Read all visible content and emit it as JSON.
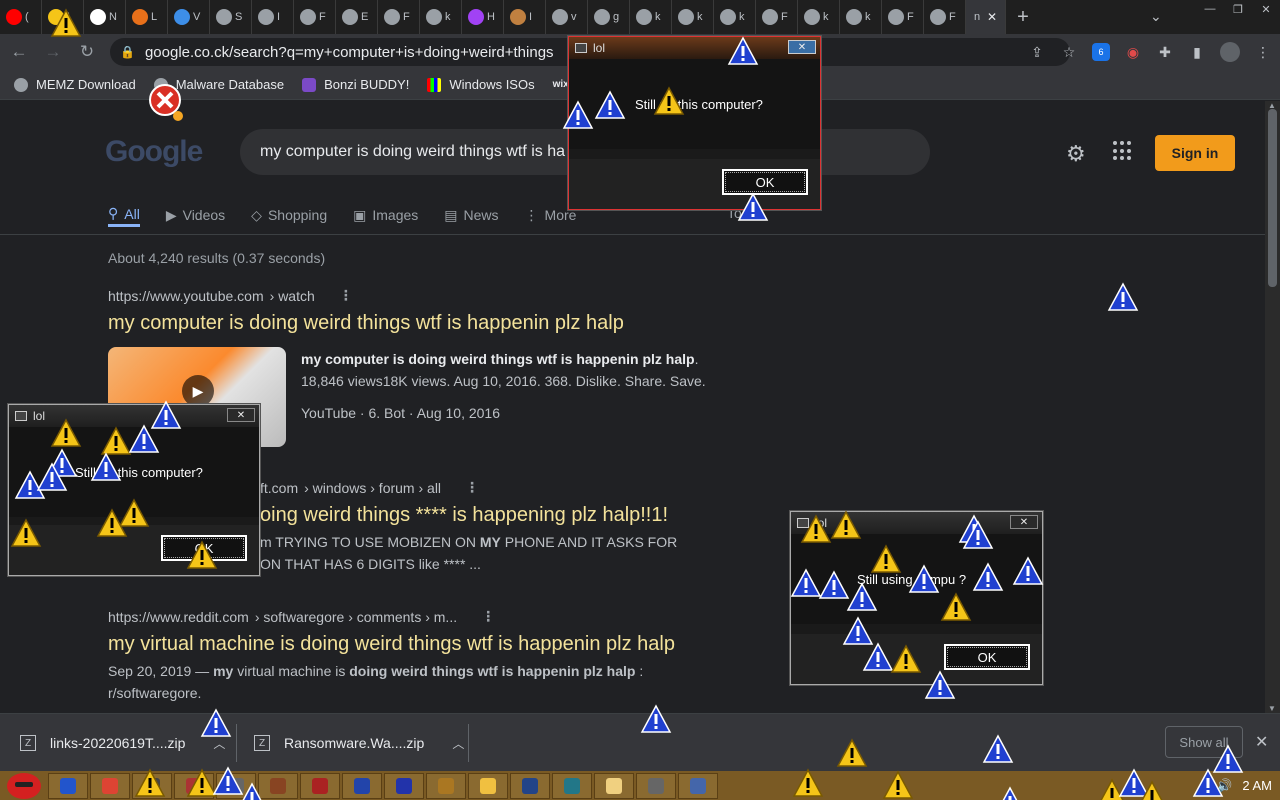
{
  "browser": {
    "tabs": [
      {
        "label": "(",
        "icon": "youtube-icon",
        "color": "#ff0000"
      },
      {
        "label": "I",
        "icon": "warning-icon",
        "color": "#f5c518"
      },
      {
        "label": "N",
        "icon": "github-icon",
        "color": "#ffffff"
      },
      {
        "label": "L",
        "icon": "bonzi-icon",
        "color": "#e8701a"
      },
      {
        "label": "V",
        "icon": "reddit-icon",
        "color": "#3d8ee8"
      },
      {
        "label": "S",
        "icon": "google-icon",
        "color": "#9aa0a6"
      },
      {
        "label": "I",
        "icon": "github-icon",
        "color": "#9aa0a6"
      },
      {
        "label": "F",
        "icon": "google-icon",
        "color": "#9aa0a6"
      },
      {
        "label": "E",
        "icon": "chrome-icon",
        "color": "#9aa0a6"
      },
      {
        "label": "F",
        "icon": "google-icon",
        "color": "#9aa0a6"
      },
      {
        "label": "k",
        "icon": "google-icon",
        "color": "#9aa0a6"
      },
      {
        "label": "H",
        "icon": "purple-icon",
        "color": "#a142f4"
      },
      {
        "label": "I",
        "icon": "box-icon",
        "color": "#c08040"
      },
      {
        "label": "v",
        "icon": "google-icon",
        "color": "#9aa0a6"
      },
      {
        "label": "g",
        "icon": "google-icon",
        "color": "#9aa0a6"
      },
      {
        "label": "k",
        "icon": "google-icon",
        "color": "#9aa0a6"
      },
      {
        "label": "k",
        "icon": "google-icon",
        "color": "#9aa0a6"
      },
      {
        "label": "k",
        "icon": "google-icon",
        "color": "#9aa0a6"
      },
      {
        "label": "F",
        "icon": "google-icon",
        "color": "#9aa0a6"
      },
      {
        "label": "k",
        "icon": "google-icon",
        "color": "#9aa0a6"
      },
      {
        "label": "k",
        "icon": "google-icon",
        "color": "#9aa0a6"
      },
      {
        "label": "F",
        "icon": "google-icon",
        "color": "#9aa0a6"
      },
      {
        "label": "F",
        "icon": "google-icon",
        "color": "#9aa0a6"
      }
    ],
    "active_tab_label": "n",
    "url": "google.co.ck/search?q=my+computer+is+doing+weird+things",
    "extension_badge": "6",
    "bookmarks": [
      "MEMZ Download",
      "Malware Database",
      "Bonzi BUDDY!",
      "Windows ISOs",
      "wix"
    ]
  },
  "search": {
    "logo": "Google",
    "query": "my computer is doing weird things wtf is ha",
    "signin_label": "Sign in",
    "tabs": [
      "All",
      "Videos",
      "Shopping",
      "Images",
      "News",
      "More"
    ],
    "tools_label": "Tools",
    "stats": "About 4,240 results (0.37 seconds)",
    "results": [
      {
        "url": "https://www.youtube.com",
        "path": "› watch",
        "title": "my computer is doing weird things wtf is happenin plz halp",
        "snippet_bold": "my computer is doing weird things wtf is happenin plz halp",
        "snippet_line2": "18,846 views18K views. Aug 10, 2016. 368. Dislike. Share. Save.",
        "meta": "YouTube · 6. Bot · Aug 10, 2016"
      },
      {
        "url": "ft.com",
        "path": "› windows › forum › all",
        "title": "oing weird things **** is happening plz halp!!1!",
        "snippet_a": "m TRYING TO USE MOBIZEN ON ",
        "snippet_bold": "MY",
        "snippet_b": " PHONE AND IT ASKS FOR",
        "snippet_line2": "ON THAT HAS 6 DIGITS like **** ..."
      },
      {
        "url": "https://www.reddit.com",
        "path": "› softwaregore › comments › m...",
        "title": "my virtual machine is doing weird things wtf is happenin plz halp",
        "snippet_pre": "Sep 20, 2019 — ",
        "snippet_b1": "my",
        "snippet_mid": " virtual machine is ",
        "snippet_b2": "doing weird things wtf is happenin plz halp",
        "snippet_end": " :",
        "snippet_line2": "r/softwaregore."
      }
    ]
  },
  "dialogs": [
    {
      "title": "lol",
      "message": "Still using this computer?",
      "message_visible": "Still    ng this computer?",
      "ok": "OK"
    },
    {
      "title": "lol",
      "message": "Still using this computer?",
      "message_visible": "Still    ng this computer?",
      "ok": "OK"
    },
    {
      "title": "lol",
      "message": "Still using this computer?",
      "message_visible": "Still using    compu    ?",
      "ok": "OK"
    }
  ],
  "downloads": {
    "items": [
      "links-20220619T....zip",
      "Ransomware.Wa....zip"
    ],
    "show_all": "Show all"
  },
  "taskbar": {
    "clock": "2 AM"
  },
  "colors": {
    "accent": "#8ab4f8",
    "result_title": "#f3e29b",
    "signin": "#f29b1b",
    "taskbar": "#7a5a24",
    "warning_yellow": "#f5c518",
    "warning_blue": "#2040d0"
  }
}
